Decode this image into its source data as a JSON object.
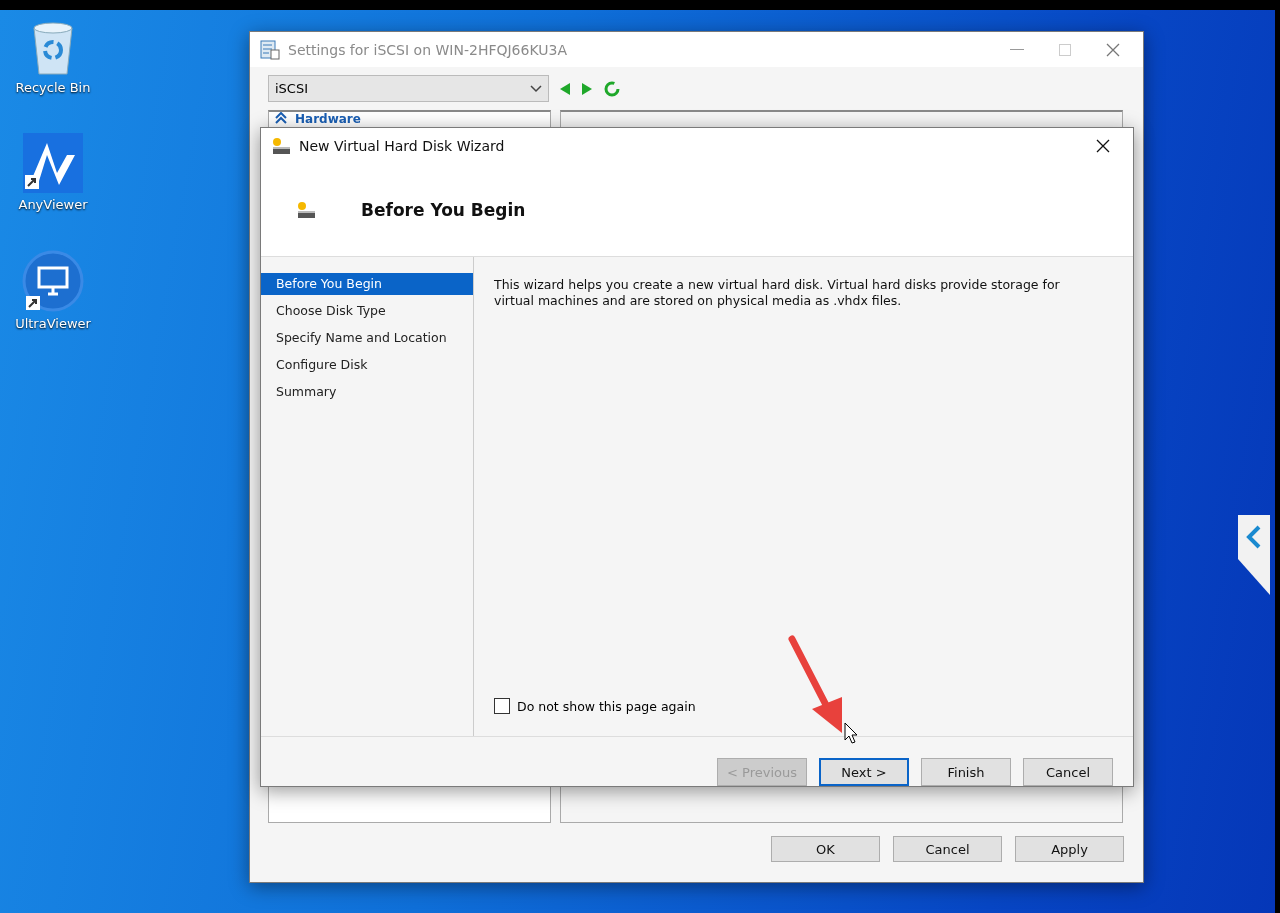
{
  "desktop": {
    "icons": [
      {
        "kind": "recycle",
        "label": "Recycle Bin"
      },
      {
        "kind": "anyviewer",
        "label": "AnyViewer"
      },
      {
        "kind": "ultraviewer",
        "label": "UltraViewer"
      }
    ]
  },
  "settings_window": {
    "title": "Settings for iSCSI on WIN-2HFQJ66KU3A",
    "dropdown": {
      "value": "iSCSI"
    },
    "tree_heading": "Hardware",
    "buttons": [
      {
        "label": "OK"
      },
      {
        "label": "Cancel"
      },
      {
        "label": "Apply"
      }
    ]
  },
  "wizard": {
    "title": "New Virtual Hard Disk Wizard",
    "heading": "Before You Begin",
    "steps": [
      {
        "label": "Before You Begin",
        "selected": true
      },
      {
        "label": "Choose Disk Type",
        "selected": false
      },
      {
        "label": "Specify Name and Location",
        "selected": false
      },
      {
        "label": "Configure Disk",
        "selected": false
      },
      {
        "label": "Summary",
        "selected": false
      }
    ],
    "description": "This wizard helps you create a new virtual hard disk. Virtual hard disks provide storage for virtual machines and are stored on physical media as .vhdx files.",
    "checkbox": {
      "label": "Do not show this page again",
      "checked": false
    },
    "buttons": [
      {
        "label": "< Previous",
        "disabled": true,
        "focused": false
      },
      {
        "label": "Next >",
        "disabled": false,
        "focused": true
      },
      {
        "label": "Finish",
        "disabled": false,
        "focused": false
      },
      {
        "label": "Cancel",
        "disabled": false,
        "focused": false
      }
    ]
  }
}
